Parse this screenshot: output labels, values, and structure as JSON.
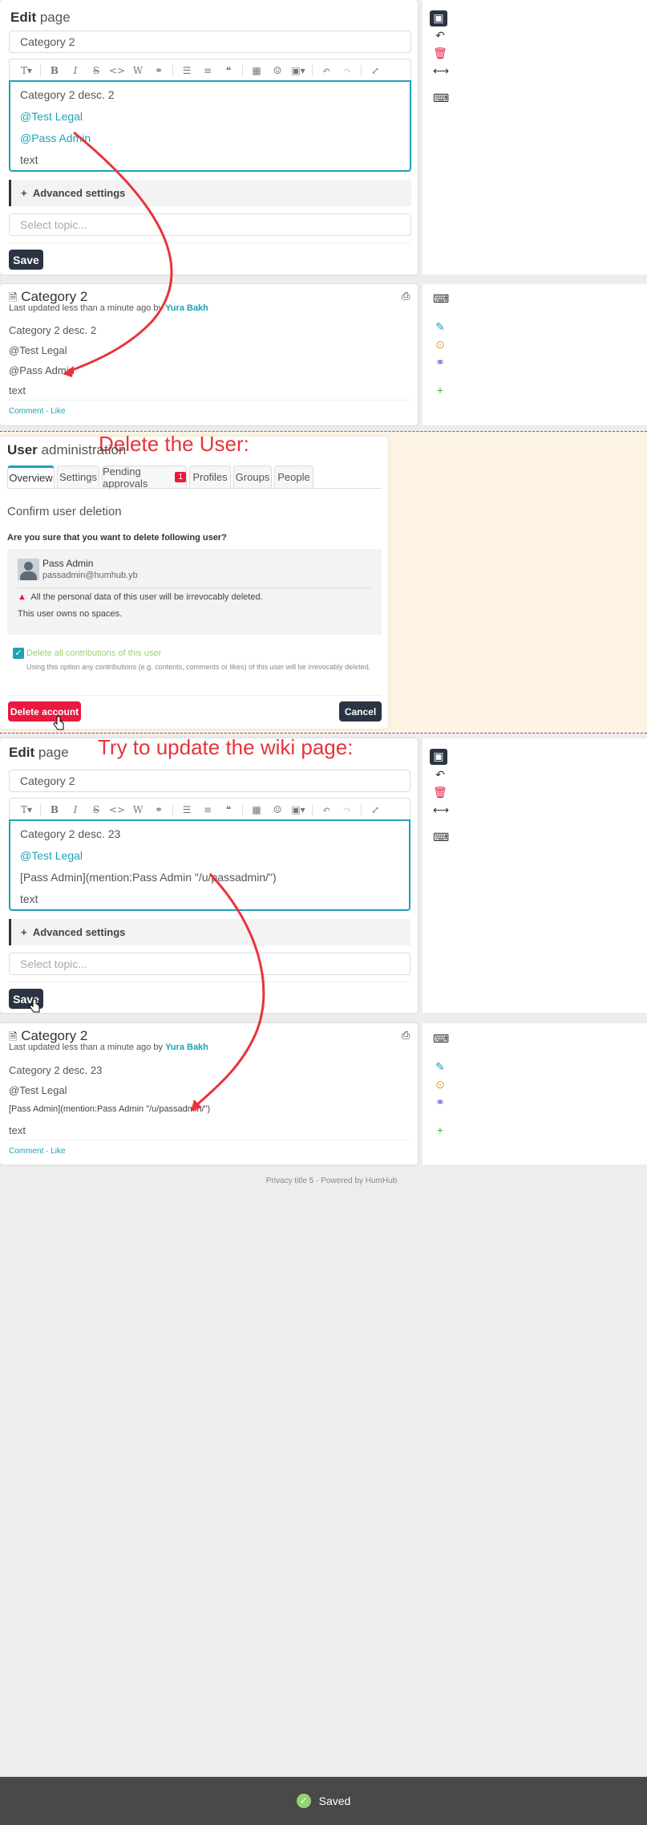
{
  "colors": {
    "accent": "#21a1b3",
    "danger": "#e9193f",
    "dark": "#2a3442",
    "annotation": "#e8333a",
    "success": "#97d271"
  },
  "icons": [
    "save-icon",
    "undo-icon",
    "trash-icon",
    "arrows-h-icon",
    "keyboard-icon",
    "pencil-icon",
    "history-icon",
    "link-icon",
    "plus-icon",
    "print-icon",
    "file-icon",
    "warning-icon",
    "check-icon",
    "pointer-icon"
  ],
  "edit1": {
    "title_bold": "Edit",
    "title_rest": "page",
    "title_input": "Category 2",
    "lines": [
      "Category 2 desc. 2",
      "@Test Legal",
      "@Pass Admin",
      "text"
    ],
    "advanced": "Advanced settings",
    "topic_placeholder": "Select topic...",
    "save": "Save"
  },
  "view1": {
    "title": "Category 2",
    "updated": "Last updated less than a minute ago by",
    "author": "Yura Bakh",
    "lines": [
      "Category 2 desc. 2",
      "@Test Legal",
      "@Pass Admin",
      "text"
    ],
    "comment": "Comment",
    "like": "Like"
  },
  "annotations": {
    "delete_user": "Delete the User:",
    "try_update": "Try to update the wiki page:"
  },
  "admin": {
    "title_bold": "User",
    "title_rest": "administration",
    "tabs": [
      "Overview",
      "Settings",
      "Pending approvals",
      "Profiles",
      "Groups",
      "People"
    ],
    "pending_count": "1",
    "confirm_title": "Confirm user deletion",
    "question": "Are you sure that you want to delete following user?",
    "user_name": "Pass Admin",
    "user_email": "passadmin@humhub.yb",
    "warning": "All the personal data of this user will be irrevocably deleted.",
    "no_spaces": "This user owns no spaces.",
    "checkbox_label": "Delete all contributions of this user",
    "checkbox_hint": "Using this option any contributions (e.g. contents, comments or likes) of this user will be irrevocably deleted.",
    "delete_btn": "Delete account",
    "cancel_btn": "Cancel"
  },
  "edit2": {
    "title_bold": "Edit",
    "title_rest": "page",
    "title_input": "Category 2",
    "lines": [
      "Category 2 desc. 23",
      "@Test Legal",
      "[Pass Admin](mention:Pass Admin \"/u/passadmin/\")",
      "text"
    ],
    "advanced": "Advanced settings",
    "topic_placeholder": "Select topic...",
    "save": "Save"
  },
  "view2": {
    "title": "Category 2",
    "updated": "Last updated less than a minute ago by",
    "author": "Yura Bakh",
    "lines": [
      "Category 2 desc. 23",
      "@Test Legal",
      "[Pass Admin](mention:Pass Admin \"/u/passadmin/\")",
      "text"
    ],
    "comment": "Comment",
    "like": "Like"
  },
  "footer": {
    "privacy": "Privacy title 5",
    "powered": "Powered by",
    "humhub": "HumHub"
  },
  "toast": "Saved"
}
